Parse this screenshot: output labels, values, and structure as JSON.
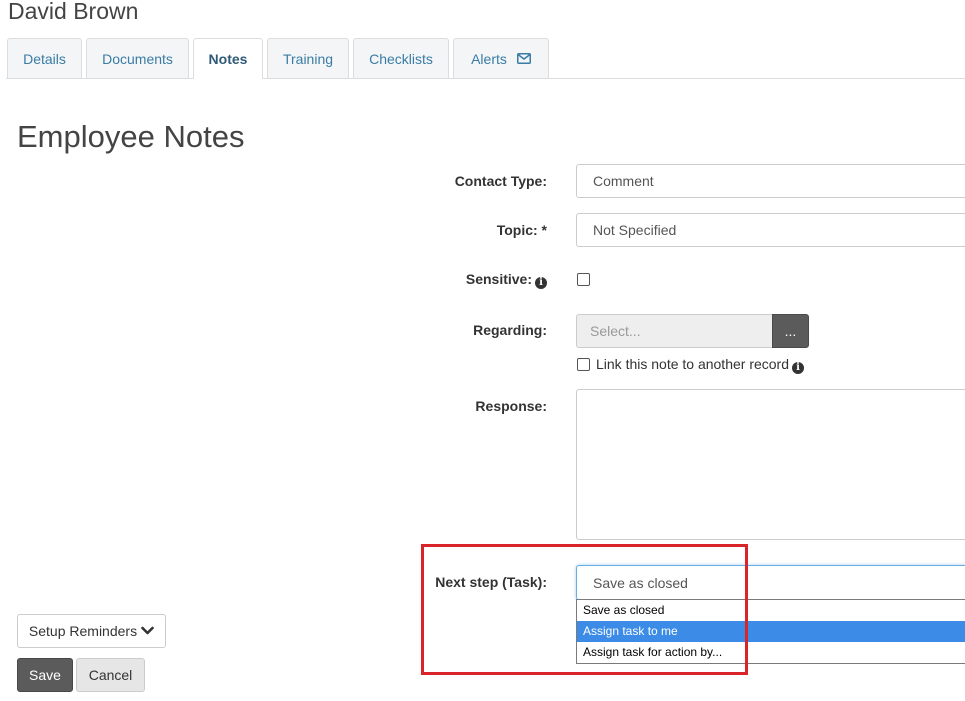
{
  "header": {
    "person_name": "David Brown"
  },
  "tabs": [
    {
      "label": "Details"
    },
    {
      "label": "Documents"
    },
    {
      "label": "Notes"
    },
    {
      "label": "Training"
    },
    {
      "label": "Checklists"
    },
    {
      "label": "Alerts",
      "icon": "envelope-icon"
    }
  ],
  "active_tab": "Notes",
  "page": {
    "title": "Employee Notes"
  },
  "form": {
    "contact_type": {
      "label": "Contact Type:",
      "value": "Comment"
    },
    "topic": {
      "label": "Topic: *",
      "value": "Not Specified"
    },
    "sensitive": {
      "label": "Sensitive:",
      "checked": false,
      "icon": "info-icon"
    },
    "regarding": {
      "label": "Regarding:",
      "placeholder": "Select...",
      "browse_label": "..."
    },
    "link_note": {
      "label": "Link this note to another record",
      "checked": false,
      "icon": "info-icon"
    },
    "response": {
      "label": "Response:",
      "value": ""
    },
    "next_step": {
      "label": "Next step (Task):",
      "value": "Save as closed",
      "options": [
        "Save as closed",
        "Assign task to me",
        "Assign task for action by..."
      ],
      "highlighted_option": "Assign task to me"
    }
  },
  "buttons": {
    "setup_reminders": "Setup Reminders",
    "save": "Save",
    "cancel": "Cancel"
  },
  "colors": {
    "tab_text": "#3a7ca5",
    "highlight_border": "#d9252a",
    "dropdown_selected": "#3c8ce7",
    "primary_button": "#5b5b5b"
  }
}
